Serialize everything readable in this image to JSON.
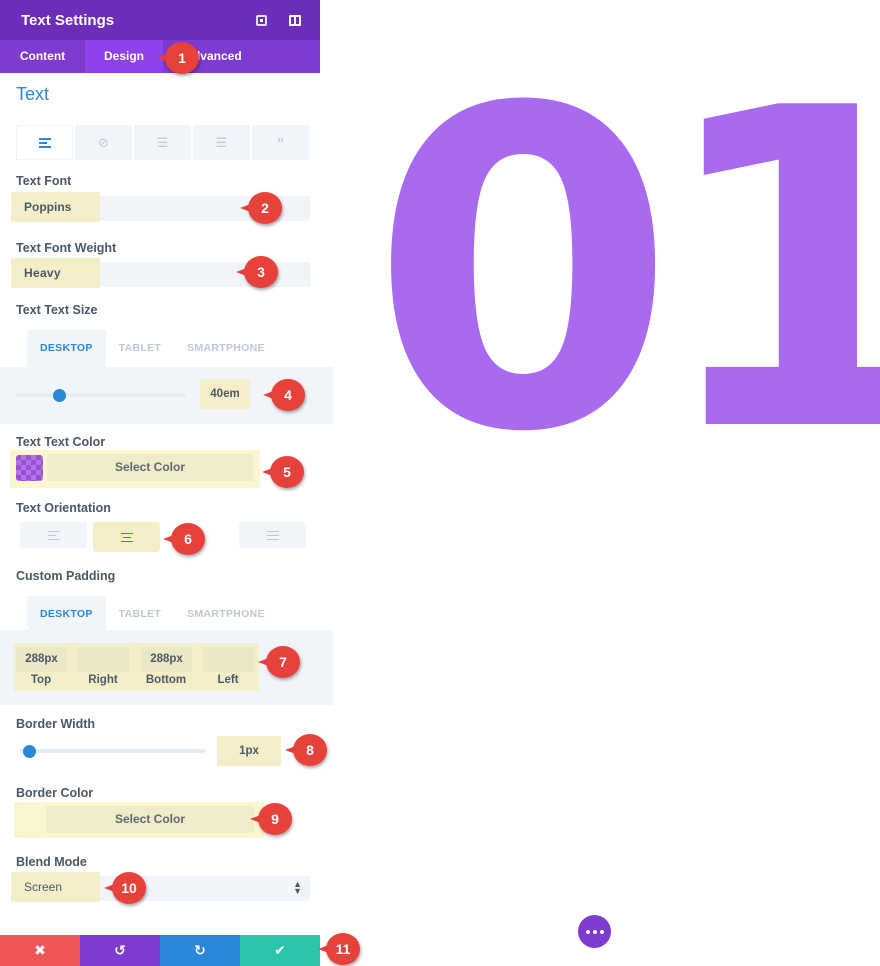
{
  "panel": {
    "title": "Text Settings",
    "header_icons": [
      "expand-icon",
      "sidebar-icon"
    ],
    "tabs": [
      {
        "label": "Content",
        "active": false
      },
      {
        "label": "Design",
        "active": true
      },
      {
        "label": "Advanced",
        "active": false
      }
    ],
    "section_title": "Text",
    "text_style_tabs": [
      {
        "icon": "align-left-icon",
        "active": true
      },
      {
        "icon": "link-icon",
        "active": false
      },
      {
        "icon": "unordered-list-icon",
        "active": false
      },
      {
        "icon": "ordered-list-icon",
        "active": false
      },
      {
        "icon": "quote-icon",
        "active": false
      }
    ],
    "text_font": {
      "label": "Text Font",
      "value": "Poppins"
    },
    "text_font_weight": {
      "label": "Text Font Weight",
      "value": "Heavy"
    },
    "text_size": {
      "label": "Text Text Size",
      "devices": [
        "DESKTOP",
        "TABLET",
        "SMARTPHONE"
      ],
      "active_device": "DESKTOP",
      "value": "40em",
      "slider_fraction": 0.25
    },
    "text_color": {
      "label": "Text Text Color",
      "button": "Select Color",
      "swatch": "#a96af0"
    },
    "text_orientation": {
      "label": "Text Orientation",
      "options": [
        "left",
        "center",
        "right",
        "justify"
      ],
      "selected": "center"
    },
    "custom_padding": {
      "label": "Custom Padding",
      "devices": [
        "DESKTOP",
        "TABLET",
        "SMARTPHONE"
      ],
      "active_device": "DESKTOP",
      "fields": [
        {
          "label": "Top",
          "value": "288px"
        },
        {
          "label": "Right",
          "value": ""
        },
        {
          "label": "Bottom",
          "value": "288px"
        },
        {
          "label": "Left",
          "value": ""
        }
      ]
    },
    "border_width": {
      "label": "Border Width",
      "value": "1px",
      "slider_fraction": 0.02
    },
    "border_color": {
      "label": "Border Color",
      "button": "Select Color"
    },
    "blend_mode": {
      "label": "Blend Mode",
      "value": "Screen"
    },
    "footer": {
      "cancel": "✖",
      "undo": "↺",
      "redo": "↻",
      "save": "✔"
    }
  },
  "annotations": [
    "1",
    "2",
    "3",
    "4",
    "5",
    "6",
    "7",
    "8",
    "9",
    "10",
    "11"
  ],
  "preview": {
    "text": "01",
    "text_color": "#a96af0",
    "more_button": "more-options"
  },
  "colors": {
    "header": "#6c2eb9",
    "tabs": "#7e3bd0",
    "accent_blue": "#2b87da",
    "highlight": "#f4efc8",
    "cancel": "#ef5555",
    "save": "#29c4a9",
    "marker": "#e6413b"
  }
}
